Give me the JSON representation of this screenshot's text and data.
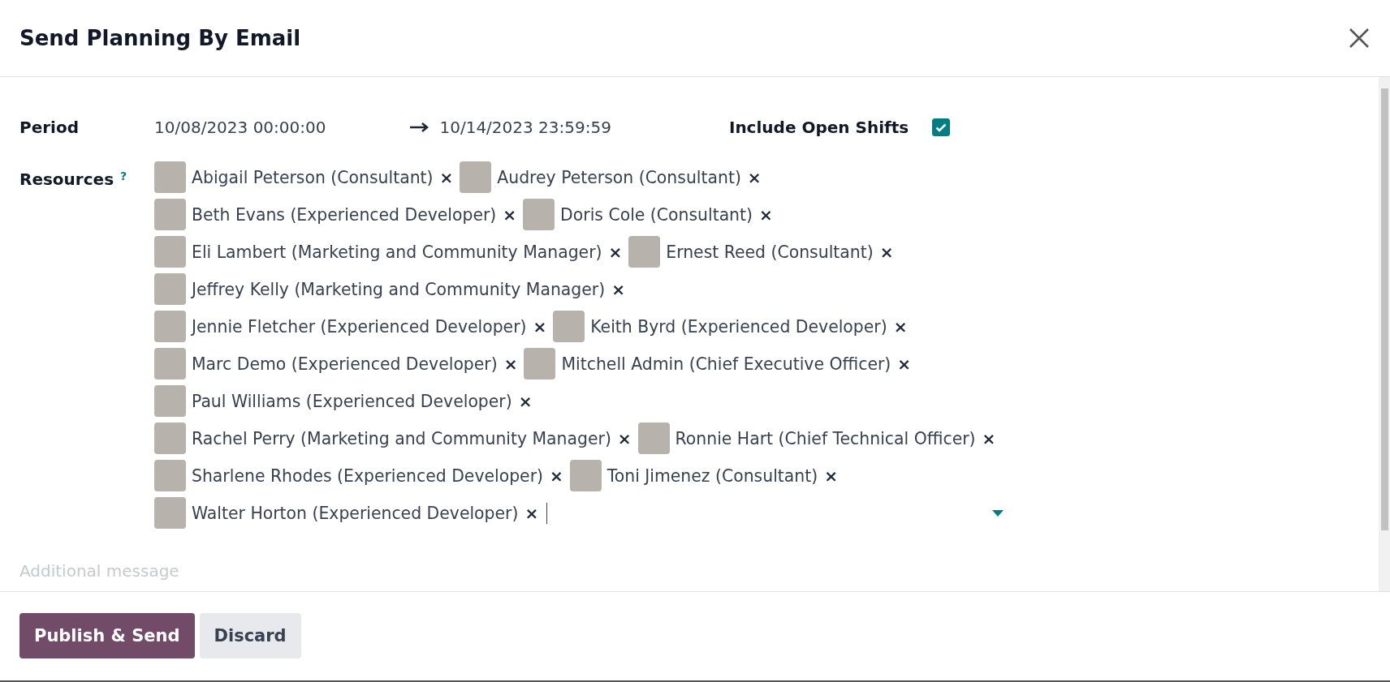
{
  "dialog": {
    "title": "Send Planning By Email"
  },
  "period": {
    "label": "Period",
    "start": "10/08/2023 00:00:00",
    "end": "10/14/2023 23:59:59"
  },
  "open_shifts": {
    "label": "Include Open Shifts",
    "checked": true
  },
  "resources": {
    "label": "Resources",
    "help": "?",
    "tags": [
      {
        "name": "Abigail Peterson (Consultant)",
        "remove": "×"
      },
      {
        "name": "Audrey Peterson (Consultant)",
        "remove": "×"
      },
      {
        "name": "Beth Evans (Experienced Developer)",
        "remove": "×"
      },
      {
        "name": "Doris Cole (Consultant)",
        "remove": "×"
      },
      {
        "name": "Eli Lambert (Marketing and Community Manager)",
        "remove": "×"
      },
      {
        "name": "Ernest Reed (Consultant)",
        "remove": "×"
      },
      {
        "name": "Jeffrey Kelly (Marketing and Community Manager)",
        "remove": "×"
      },
      {
        "name": "Jennie Fletcher (Experienced Developer)",
        "remove": "×"
      },
      {
        "name": "Keith Byrd (Experienced Developer)",
        "remove": "×"
      },
      {
        "name": "Marc Demo (Experienced Developer)",
        "remove": "×"
      },
      {
        "name": "Mitchell Admin (Chief Executive Officer)",
        "remove": "×"
      },
      {
        "name": "Paul Williams (Experienced Developer)",
        "remove": "×"
      },
      {
        "name": "Rachel Perry (Marketing and Community Manager)",
        "remove": "×"
      },
      {
        "name": "Ronnie Hart (Chief Technical Officer)",
        "remove": "×"
      },
      {
        "name": "Sharlene Rhodes (Experienced Developer)",
        "remove": "×"
      },
      {
        "name": "Toni Jimenez (Consultant)",
        "remove": "×"
      },
      {
        "name": "Walter Horton (Experienced Developer)",
        "remove": "×"
      }
    ]
  },
  "message": {
    "placeholder": "Additional message"
  },
  "buttons": [
    {
      "label": "Publish & Send",
      "kind": "primary"
    },
    {
      "label": "Discard",
      "kind": "secondary"
    }
  ]
}
